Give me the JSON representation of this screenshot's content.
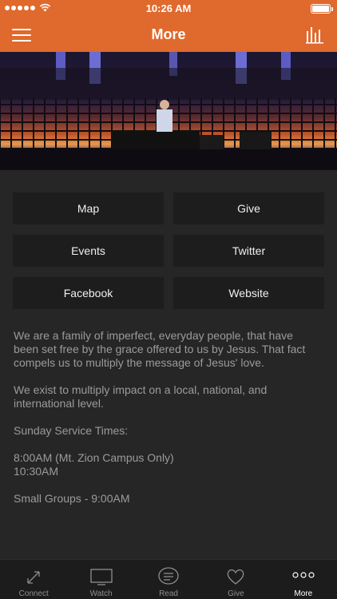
{
  "status_bar": {
    "time": "10:26 AM"
  },
  "header": {
    "title": "More"
  },
  "buttons": [
    {
      "label": "Map"
    },
    {
      "label": "Give"
    },
    {
      "label": "Events"
    },
    {
      "label": "Twitter"
    },
    {
      "label": "Facebook"
    },
    {
      "label": "Website"
    }
  ],
  "about": {
    "paragraphs": [
      "We are a family of imperfect, everyday people, that have been set free by the grace offered to us by Jesus. That fact compels us to multiply the message of Jesus' love.",
      "We exist to multiply impact on a local, national, and international level.",
      "Sunday Service Times:",
      "8:00AM (Mt. Zion Campus Only)\n10:30AM",
      "Small Groups - 9:00AM"
    ]
  },
  "tabs": [
    {
      "label": "Connect",
      "icon": "connect-icon"
    },
    {
      "label": "Watch",
      "icon": "tv-icon"
    },
    {
      "label": "Read",
      "icon": "chat-bubble-icon"
    },
    {
      "label": "Give",
      "icon": "heart-icon"
    },
    {
      "label": "More",
      "icon": "ellipsis-icon"
    }
  ],
  "colors": {
    "brand": "#e0692d",
    "background": "#262626",
    "button": "#1d1d1d"
  }
}
